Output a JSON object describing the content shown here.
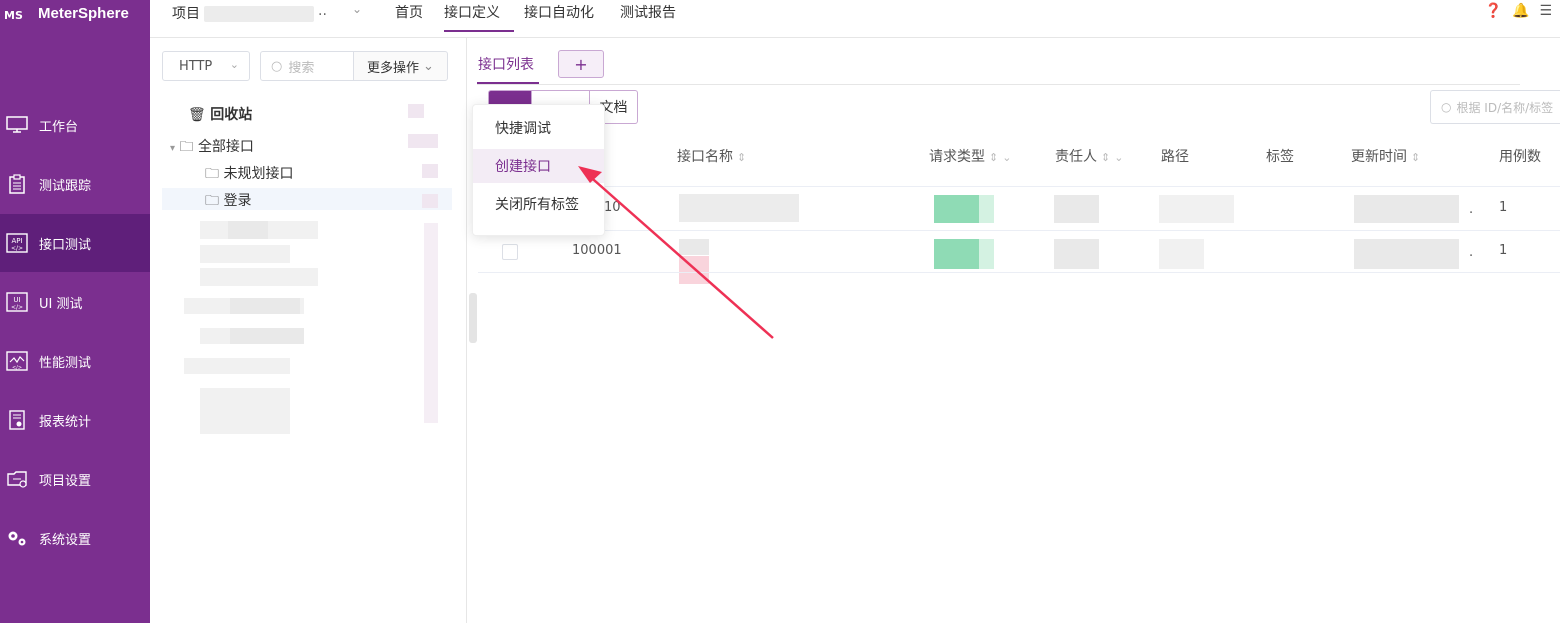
{
  "brand": {
    "logo_text": "MS",
    "name": "MeterSphere"
  },
  "sidebar": {
    "items": [
      {
        "label": "工作台",
        "icon": "monitor-icon"
      },
      {
        "label": "测试跟踪",
        "icon": "clipboard-icon"
      },
      {
        "label": "接口测试",
        "icon": "api-icon",
        "active": true
      },
      {
        "label": "UI 测试",
        "icon": "ui-test-icon"
      },
      {
        "label": "性能测试",
        "icon": "performance-chart-icon"
      },
      {
        "label": "报表统计",
        "icon": "report-icon"
      },
      {
        "label": "项目设置",
        "icon": "project-settings-icon"
      },
      {
        "label": "系统设置",
        "icon": "gears-icon"
      }
    ]
  },
  "topbar": {
    "project_label": "项目",
    "project_ellipsis": "..",
    "menu": [
      "首页",
      "接口定义",
      "接口自动化",
      "测试报告"
    ],
    "active_menu": "接口定义",
    "icons": [
      "help-icon",
      "bell-icon",
      "list-icon"
    ]
  },
  "tree": {
    "protocol": "HTTP",
    "search_placeholder": "搜索",
    "more_ops": "更多操作",
    "recycle": "回收站",
    "all_apis": "全部接口",
    "unplanned": "未规划接口",
    "login": "登录"
  },
  "main": {
    "tab_label": "接口列表",
    "add_tab": "+",
    "segment_doc": "文档",
    "search_placeholder": "根据 ID/名称/标签"
  },
  "table": {
    "columns": [
      "接口名称",
      "请求类型",
      "责任人",
      "路径",
      "标签",
      "更新时间",
      "用例数"
    ],
    "rows": [
      {
        "id": "10",
        "case_count": "1",
        "dot": "."
      },
      {
        "id": "100001",
        "case_count": "1",
        "dot": "."
      }
    ]
  },
  "dropdown": {
    "items": [
      "快捷调试",
      "创建接口",
      "关闭所有标签"
    ],
    "highlighted": "创建接口"
  },
  "colors": {
    "brand": "#7b2f8f",
    "sidebar_active": "#5f1f7a",
    "annotation_arrow": "#ee3155"
  }
}
